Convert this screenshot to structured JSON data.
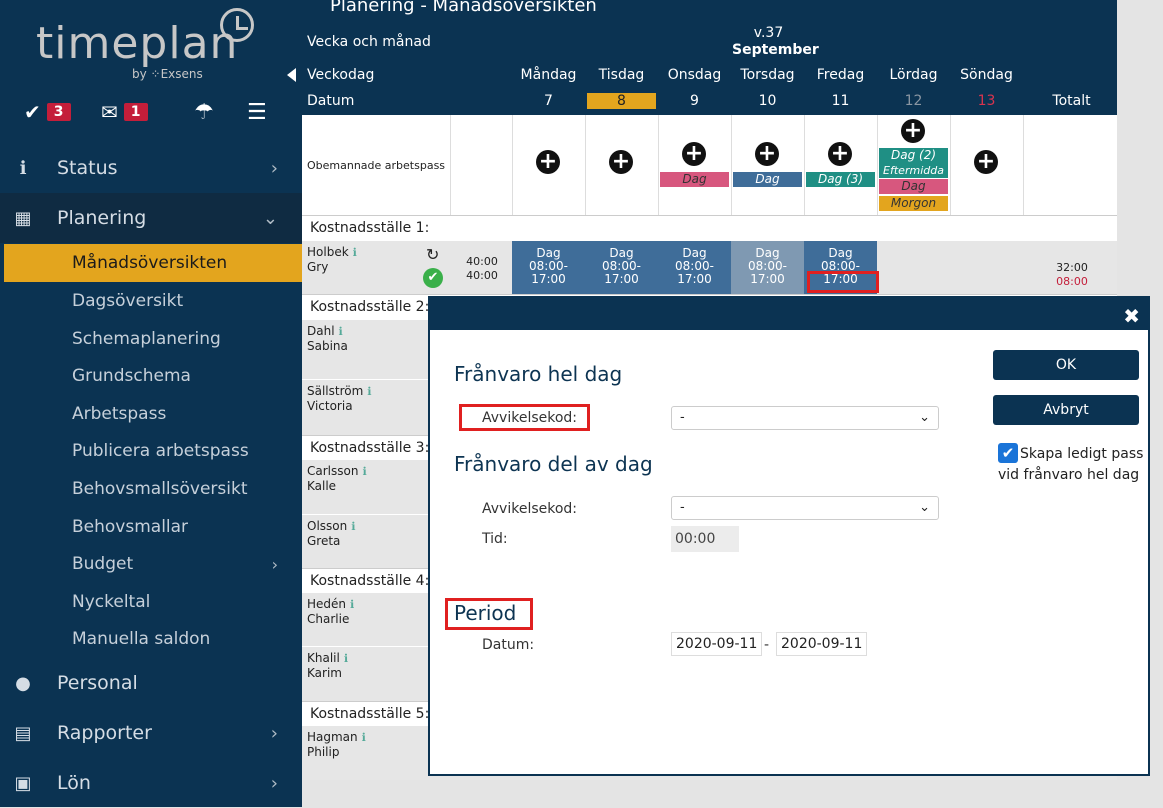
{
  "sidebar": {
    "logo": {
      "word": "timeplan",
      "by": "by ⁘Exsens"
    },
    "quick": {
      "tasks_count": "3",
      "messages_count": "1"
    },
    "nav": [
      {
        "label": "Status"
      },
      {
        "label": "Planering"
      },
      {
        "label": "Personal"
      },
      {
        "label": "Rapporter"
      },
      {
        "label": "Lön"
      }
    ],
    "planering_items": [
      "Månadsöversikten",
      "Dagsöversikt",
      "Schemaplanering",
      "Grundschema",
      "Arbetspass",
      "Publicera arbetspass",
      "Behovsmallsöversikt",
      "Behovsmallar",
      "Budget",
      "Nyckeltal",
      "Manuella saldon"
    ]
  },
  "page": {
    "title": "Planering - Månadsöversikten"
  },
  "header": {
    "week_label": "Vecka och månad",
    "week": "v.37",
    "month": "September",
    "weekday_label": "Veckodag",
    "date_label": "Datum",
    "days": [
      "Måndag",
      "Tisdag",
      "Onsdag",
      "Torsdag",
      "Fredag",
      "Lördag",
      "Söndag"
    ],
    "dates": [
      "7",
      "8",
      "9",
      "10",
      "11",
      "12",
      "13"
    ],
    "total_label": "Totalt"
  },
  "unmanned": {
    "label": "Obemannade arbetspass",
    "tags": {
      "wed": "Dag",
      "thu": "Dag",
      "fri": "Dag (3)",
      "sat1": "Dag (2)",
      "sat2": "Eftermidda",
      "sat3": "Dag",
      "sat4": "Morgon"
    }
  },
  "sections": [
    "Kostnadsställe 1:",
    "Kostnadsställe 2:",
    "Kostnadsställe 3:",
    "Kostnadsställe 4:",
    "Kostnadsställe 5:"
  ],
  "people": [
    {
      "last": "Holbek",
      "first": "Gry"
    },
    {
      "last": "Dahl",
      "first": "Sabina"
    },
    {
      "last": "Sällström",
      "first": "Victoria"
    },
    {
      "last": "Carlsson",
      "first": "Kalle"
    },
    {
      "last": "Olsson",
      "first": "Greta"
    },
    {
      "last": "Hedén",
      "first": "Charlie"
    },
    {
      "last": "Khalil",
      "first": "Karim"
    },
    {
      "last": "Hagman",
      "first": "Philip"
    }
  ],
  "holbek_row": {
    "hours_a": "40:00",
    "hours_b": "40:00",
    "shift_name": "Dag",
    "shift_time": "08:00-17:00",
    "total": "32:00",
    "total_red": "08:00"
  },
  "modal": {
    "section1": "Frånvaro hel dag",
    "code_label": "Avvikelsekod:",
    "code_value": "-",
    "section2": "Frånvaro del av dag",
    "code2_label": "Avvikelsekod:",
    "code2_value": "-",
    "time_label": "Tid:",
    "time_value": "00:00",
    "section3": "Period",
    "date_label": "Datum:",
    "date_from": "2020-09-11",
    "date_sep": "-",
    "date_to": "2020-09-11",
    "ok": "OK",
    "cancel": "Avbryt",
    "checkbox_label": "Skapa ledigt pass vid frånvaro hel dag"
  }
}
